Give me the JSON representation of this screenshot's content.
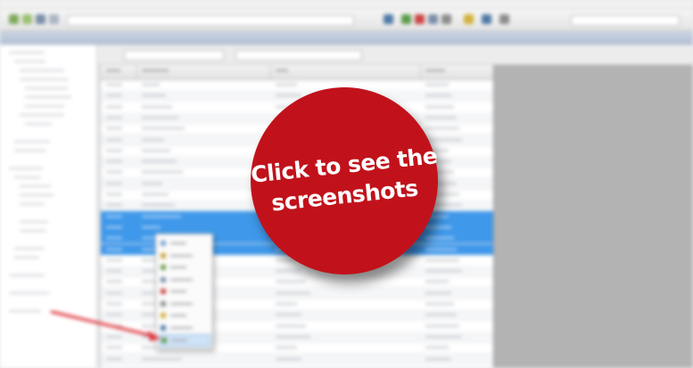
{
  "overlay": {
    "line1": "Click to see the",
    "line2": "screenshots"
  },
  "colors": {
    "cta_red": "#c1121b",
    "selection_blue": "#3f98ea",
    "arrow_red": "#e0363c"
  },
  "icons": {
    "context_menu": [
      "copy-icon",
      "paste-icon",
      "link-icon",
      "edit-icon",
      "delete-icon",
      "settings-icon",
      "folder-icon",
      "export-icon",
      "info-icon"
    ]
  }
}
